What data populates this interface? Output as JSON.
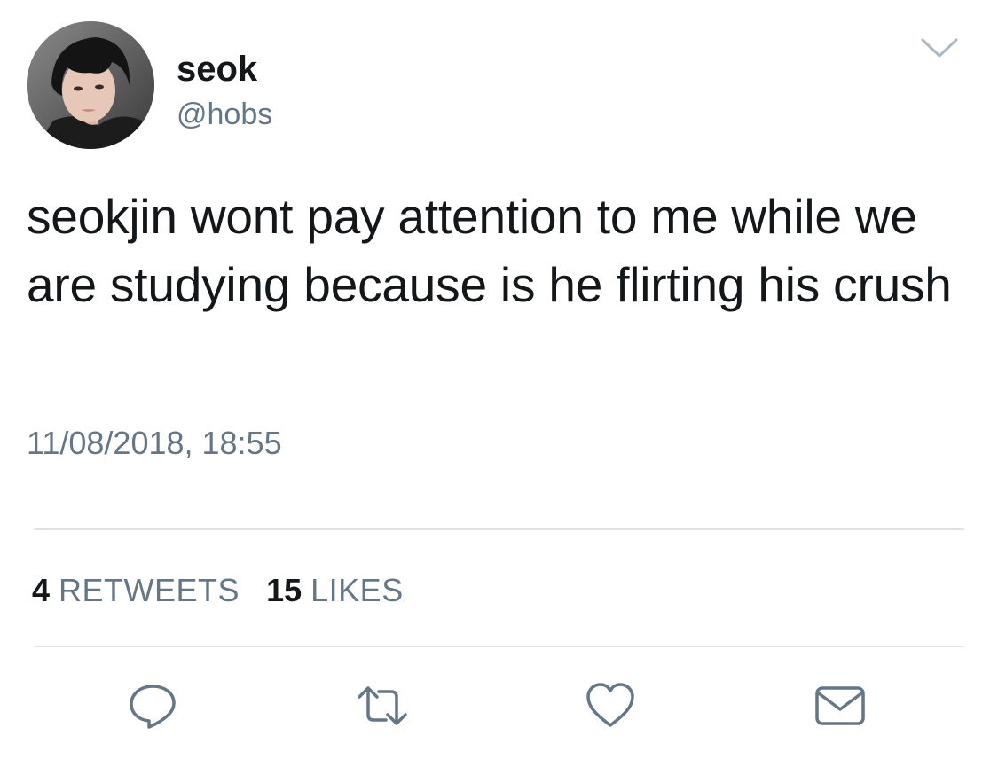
{
  "author": {
    "name": "seok",
    "handle": "@hobs",
    "avatar_icon": "profile-photo"
  },
  "tweet": {
    "text": "seokjin wont pay attention to me while we are studying because is he flirting his crush",
    "timestamp": "11/08/2018, 18:55"
  },
  "stats": {
    "retweets_count": "4",
    "retweets_label": "RETWEETS",
    "likes_count": "15",
    "likes_label": "LIKES"
  },
  "actions": [
    {
      "name": "reply",
      "icon": "reply-icon"
    },
    {
      "name": "retweet",
      "icon": "retweet-icon"
    },
    {
      "name": "like",
      "icon": "heart-icon"
    },
    {
      "name": "direct-message",
      "icon": "envelope-icon"
    }
  ],
  "colors": {
    "text_primary": "#14171a",
    "text_secondary": "#657786",
    "icon": "#657786",
    "divider": "#dfe3e7",
    "background": "#ffffff"
  }
}
